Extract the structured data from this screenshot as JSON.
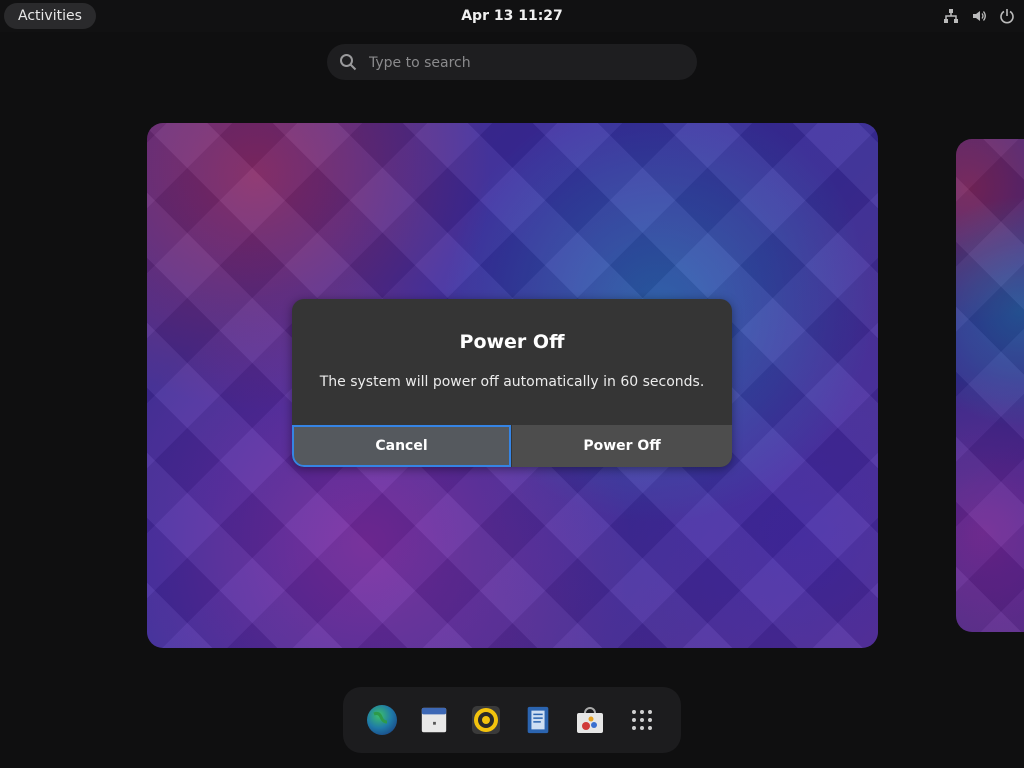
{
  "topbar": {
    "activities_label": "Activities",
    "clock": "Apr 13  11:27",
    "tray_icons": [
      "network-icon",
      "volume-icon",
      "power-icon"
    ]
  },
  "search": {
    "placeholder": "Type to search"
  },
  "dialog": {
    "title": "Power Off",
    "message": "The system will power off automatically in 60 seconds.",
    "cancel_label": "Cancel",
    "confirm_label": "Power Off"
  },
  "dash": {
    "apps": [
      "web-browser-icon",
      "calendar-icon",
      "music-player-icon",
      "text-editor-icon",
      "software-store-icon",
      "show-apps-icon"
    ]
  },
  "colors": {
    "accent": "#3584e4",
    "dialog_bg": "#353535"
  }
}
